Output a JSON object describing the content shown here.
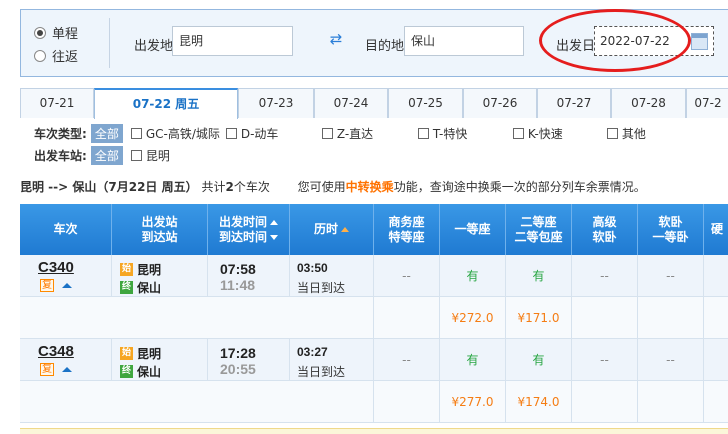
{
  "search": {
    "trip_types": [
      {
        "label": "单程",
        "checked": true
      },
      {
        "label": "往返",
        "checked": false
      }
    ],
    "from_label": "出发地",
    "from_value": "昆明",
    "to_label": "目的地",
    "to_value": "保山",
    "date_label": "出发日",
    "date_value": "2022-07-22",
    "swap_icon": "swap-arrows-icon",
    "calendar_icon": "calendar-icon"
  },
  "date_tabs": [
    {
      "label": "07-21",
      "active": false
    },
    {
      "label": "07-22 周五",
      "active": true
    },
    {
      "label": "07-23",
      "active": false
    },
    {
      "label": "07-24",
      "active": false
    },
    {
      "label": "07-25",
      "active": false
    },
    {
      "label": "07-26",
      "active": false
    },
    {
      "label": "07-27",
      "active": false
    },
    {
      "label": "07-28",
      "active": false
    },
    {
      "label": "07-2",
      "active": false
    }
  ],
  "filters": {
    "type_label": "车次类型:",
    "station_label": "出发车站:",
    "all_label": "全部",
    "types": [
      "GC-高铁/城际",
      "D-动车",
      "Z-直达",
      "T-特快",
      "K-快速",
      "其他"
    ],
    "stations": [
      "昆明"
    ]
  },
  "summary": {
    "route": "昆明 --> 保山（7月22日  周五）",
    "count_prefix": "共计",
    "count": "2",
    "count_suffix": "个车次",
    "tip_prefix": "您可使用",
    "tip_link": "中转换乘",
    "tip_suffix": "功能，查询途中换乘一次的部分列车余票情况。"
  },
  "table_headers": {
    "train": "车次",
    "station_1": "出发站",
    "station_2": "到达站",
    "time_1": "出发时间",
    "time_2": "到达时间",
    "duration": "历时",
    "biz_1": "商务座",
    "biz_2": "特等座",
    "first": "一等座",
    "second_1": "二等座",
    "second_2": "二等包座",
    "adv_1": "高级",
    "adv_2": "软卧",
    "soft_1": "软卧",
    "soft_2": "一等卧",
    "more": "硬"
  },
  "trains": [
    {
      "no": "C340",
      "fu": "复",
      "from_icon": "始",
      "from": "昆明",
      "to_icon": "终",
      "to": "保山",
      "depart": "07:58",
      "arrive": "11:48",
      "duration": "03:50",
      "arrival_note": "当日到达",
      "biz": "--",
      "first": "有",
      "second": "有",
      "adv": "--",
      "soft": "--",
      "price_first": "¥272.0",
      "price_second": "¥171.0"
    },
    {
      "no": "C348",
      "fu": "复",
      "from_icon": "始",
      "from": "昆明",
      "to_icon": "终",
      "to": "保山",
      "depart": "17:28",
      "arrive": "20:55",
      "duration": "03:27",
      "arrival_note": "当日到达",
      "biz": "--",
      "first": "有",
      "second": "有",
      "adv": "--",
      "soft": "--",
      "price_first": "¥277.0",
      "price_second": "¥174.0"
    }
  ]
}
